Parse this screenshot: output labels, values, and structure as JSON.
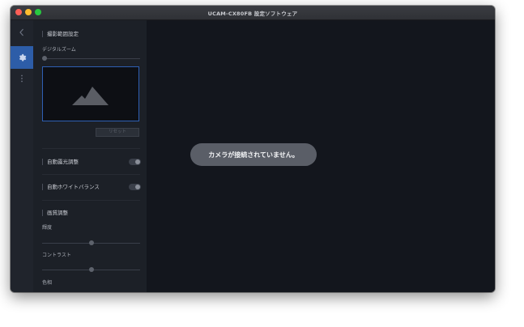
{
  "window": {
    "title": "UCAM-CX80FB 設定ソフトウェア",
    "traffic_lights": [
      "#fe5f57",
      "#febc2e",
      "#28c840"
    ]
  },
  "rail": {
    "back_icon": "chevron-left-icon",
    "active_icon": "gear-icon",
    "more_icon": "vertical-dots-icon",
    "accent": "#2d5da8"
  },
  "panel": {
    "capture_range": {
      "section_title": "撮影範囲設定",
      "digital_zoom_label": "デジタルズーム",
      "digital_zoom_level": 0,
      "reset_label": "リセット"
    },
    "auto_exposure": {
      "label": "自動露光調整",
      "enabled": false
    },
    "auto_white_balance": {
      "label": "自動ホワイトバランス",
      "enabled": false
    },
    "image_quality": {
      "section_title": "画質調整",
      "brightness_label": "輝度",
      "brightness_level": 0.5,
      "contrast_label": "コントラスト",
      "contrast_level": 0.5,
      "hue_label": "色相",
      "hue_level": 0.5
    }
  },
  "main": {
    "status_message": "カメラが接続されていません。"
  }
}
